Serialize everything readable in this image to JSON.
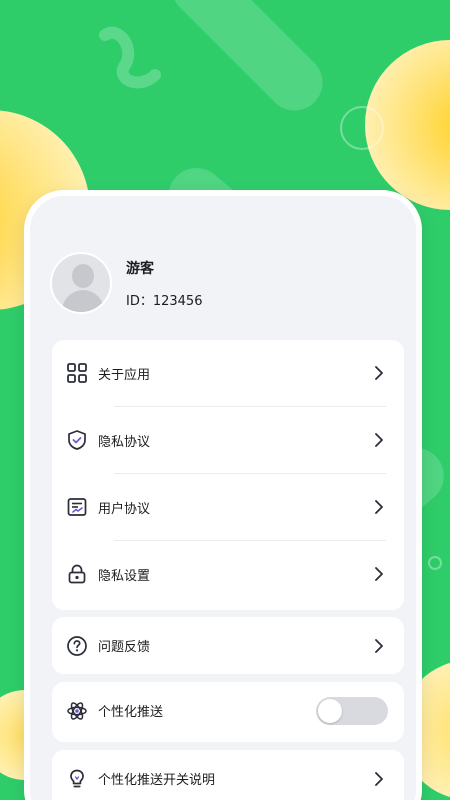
{
  "profile": {
    "name": "游客",
    "id_text": "ID：123456"
  },
  "menu": {
    "about": "关于应用",
    "privacy_policy": "隐私协议",
    "user_agreement": "用户协议",
    "privacy_settings": "隐私设置",
    "feedback": "问题反馈",
    "personalized_push": "个性化推送",
    "push_switch_info": "个性化推送开关说明"
  },
  "toggle": {
    "personalized_push_on": false
  },
  "colors": {
    "background": "#2fcd6a",
    "card": "#f2f3f7",
    "accent_yellow": "#ffd12a"
  },
  "icons": {
    "about": "grid-icon",
    "privacy_policy": "shield-check-icon",
    "user_agreement": "document-sign-icon",
    "privacy_settings": "lock-icon",
    "feedback": "question-icon",
    "personalized_push": "atom-icon",
    "push_switch_info": "lightbulb-icon",
    "chevron": "chevron-right-icon",
    "avatar": "avatar-placeholder-icon"
  }
}
